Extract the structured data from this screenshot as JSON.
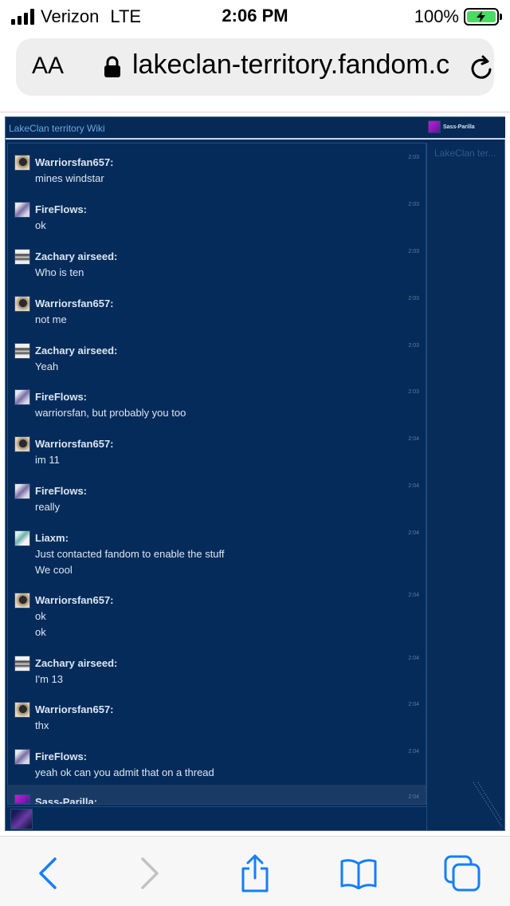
{
  "status_bar": {
    "carrier": "Verizon",
    "network": "LTE",
    "time": "2:06 PM",
    "battery": "100%"
  },
  "browser": {
    "aa_label": "AA",
    "url": "lakeclan-territory.fandom.c"
  },
  "chat": {
    "wiki_title": "LakeClan territory Wiki",
    "current_user": "Sass-Parilla",
    "userlist": [
      "LakeClan ter..."
    ],
    "messages": [
      {
        "user": "Warriorsfan657:",
        "avatar": "warrior",
        "time": "2:03",
        "lines": [
          "mines windstar"
        ]
      },
      {
        "user": "FireFlows:",
        "avatar": "fire",
        "time": "2:03",
        "lines": [
          "ok"
        ]
      },
      {
        "user": "Zachary airseed:",
        "avatar": "zach",
        "time": "2:03",
        "lines": [
          "Who is ten"
        ]
      },
      {
        "user": "Warriorsfan657:",
        "avatar": "warrior",
        "time": "2:03",
        "lines": [
          "not me"
        ]
      },
      {
        "user": "Zachary airseed:",
        "avatar": "zach",
        "time": "2:03",
        "lines": [
          "Yeah"
        ]
      },
      {
        "user": "FireFlows:",
        "avatar": "fire",
        "time": "2:03",
        "lines": [
          "warriorsfan, but probably you too"
        ]
      },
      {
        "user": "Warriorsfan657:",
        "avatar": "warrior",
        "time": "2:04",
        "lines": [
          "im 11"
        ]
      },
      {
        "user": "FireFlows:",
        "avatar": "fire",
        "time": "2:04",
        "lines": [
          "really"
        ]
      },
      {
        "user": "Liaxm:",
        "avatar": "liax",
        "time": "2:04",
        "lines": [
          "Just contacted fandom to enable the stuff",
          "We cool"
        ]
      },
      {
        "user": "Warriorsfan657:",
        "avatar": "warrior",
        "time": "2:04",
        "lines": [
          "ok",
          "ok"
        ]
      },
      {
        "user": "Zachary airseed:",
        "avatar": "zach",
        "time": "2:04",
        "lines": [
          "I'm 13"
        ]
      },
      {
        "user": "Warriorsfan657:",
        "avatar": "warrior",
        "time": "2:04",
        "lines": [
          "thx"
        ]
      },
      {
        "user": "FireFlows:",
        "avatar": "fire",
        "time": "2:04",
        "lines": [
          "yeah ok can you admit that on a thread"
        ]
      },
      {
        "user": "Sass-Parilla:",
        "avatar": "sass",
        "time": "2:04",
        "lines": []
      }
    ],
    "input_value": ""
  },
  "toolbar": {
    "back_icon": "chevron-left-icon",
    "forward_icon": "chevron-right-icon",
    "share_icon": "share-icon",
    "bookmarks_icon": "book-icon",
    "tabs_icon": "tabs-icon",
    "accent_color": "#147efb"
  }
}
